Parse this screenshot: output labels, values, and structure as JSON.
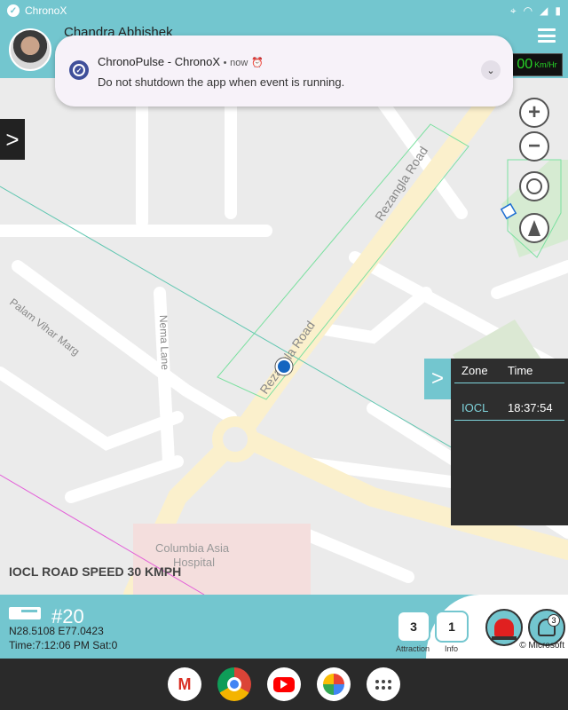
{
  "status_bar": {
    "app_name": "ChronoX"
  },
  "header": {
    "user_name": "Chandra Abhishek",
    "speed_value": "00",
    "speed_unit": "Km/Hr"
  },
  "notification": {
    "app": "ChronoPulse - ChronoX",
    "separator": "•",
    "time": "now",
    "message": "Do not shutdown the app when event is running."
  },
  "map": {
    "labels": {
      "road_1": "Rezangla Road",
      "road_2": "Rezangla Road",
      "road_3": "Palam Vihar Marg",
      "road_4": "Nema Lane",
      "poi_1": "Columbia Asia",
      "poi_2": "Hospital"
    },
    "side_toggle": ">",
    "controls": {
      "zoom_in": "+",
      "zoom_out": "−"
    },
    "road_speed": "IOCL ROAD SPEED 30 KMPH"
  },
  "zone_panel": {
    "toggle": ">",
    "headers": [
      "Zone",
      "Time"
    ],
    "rows": [
      {
        "zone": "IOCL",
        "time": "18:37:54"
      }
    ]
  },
  "info_bar": {
    "vehicle_id": "#20",
    "coordinates": "N28.5108 E77.0423",
    "time_line": "Time:7:12:06 PM Sat:0",
    "attraction_count": "3",
    "attraction_label": "Attraction",
    "info_count": "1",
    "info_label": "Info",
    "bell_badge": "3",
    "copyright": "© Microsoft"
  },
  "dock": {
    "gmail_letter": "M"
  },
  "colors": {
    "accent": "#73c6cf",
    "panel": "#2e2e2e",
    "speed_text": "#27d627",
    "alert": "#e02020"
  }
}
